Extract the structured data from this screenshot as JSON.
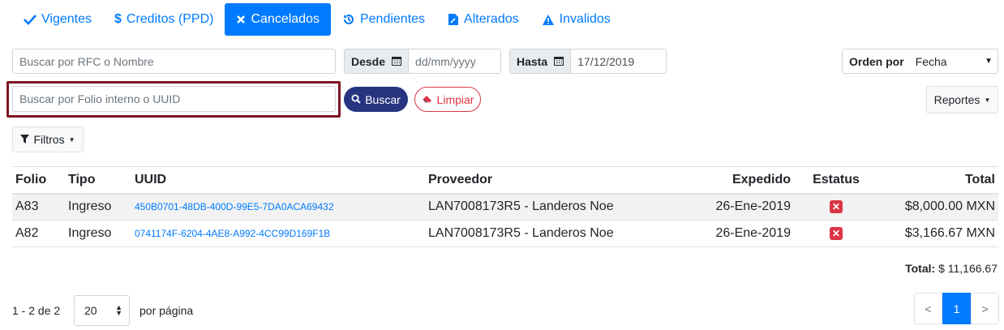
{
  "tabs": [
    {
      "label": "Vigentes",
      "icon": "check-icon"
    },
    {
      "label": "Creditos (PPD)",
      "icon": "dollar-icon"
    },
    {
      "label": "Cancelados",
      "icon": "times-icon",
      "active": true
    },
    {
      "label": "Pendientes",
      "icon": "history-icon"
    },
    {
      "label": "Alterados",
      "icon": "file-pen-icon"
    },
    {
      "label": "Invalidos",
      "icon": "warning-icon"
    }
  ],
  "filters": {
    "rfc_placeholder": "Buscar por RFC o Nombre",
    "desde_label": "Desde",
    "desde_placeholder": "dd/mm/yyyy",
    "hasta_label": "Hasta",
    "hasta_value": "17/12/2019",
    "orden_label": "Orden por",
    "orden_value": "Fecha",
    "folio_placeholder": "Buscar por Folio interno o UUID",
    "buscar_label": "Buscar",
    "limpiar_label": "Limpiar",
    "reportes_label": "Reportes",
    "filtros_label": "Filtros"
  },
  "table": {
    "headers": {
      "folio": "Folio",
      "tipo": "Tipo",
      "uuid": "UUID",
      "proveedor": "Proveedor",
      "expedido": "Expedido",
      "estatus": "Estatus",
      "total": "Total"
    },
    "rows": [
      {
        "folio": "A83",
        "tipo": "Ingreso",
        "uuid": "450B0701-48DB-400D-99E5-7DA0ACA69432",
        "proveedor": "LAN7008173R5 - Landeros Noe",
        "expedido": "26-Ene-2019",
        "total": "$8,000.00 MXN"
      },
      {
        "folio": "A82",
        "tipo": "Ingreso",
        "uuid": "0741174F-6204-4AE8-A992-4CC99D169F1B",
        "proveedor": "LAN7008173R5 - Landeros Noe",
        "expedido": "26-Ene-2019",
        "total": "$3,166.67 MXN"
      }
    ]
  },
  "summary": {
    "total_label": "Total:",
    "total_value": "$ 11,166.67"
  },
  "pagination": {
    "range_text": "1 - 2 de 2",
    "per_page_value": "20",
    "per_page_label": "por página",
    "prev": "<",
    "current": "1",
    "next": ">"
  },
  "colors": {
    "primary": "#007bff",
    "buscar": "#273580",
    "danger": "#dc3545",
    "highlight": "#7d1521"
  }
}
